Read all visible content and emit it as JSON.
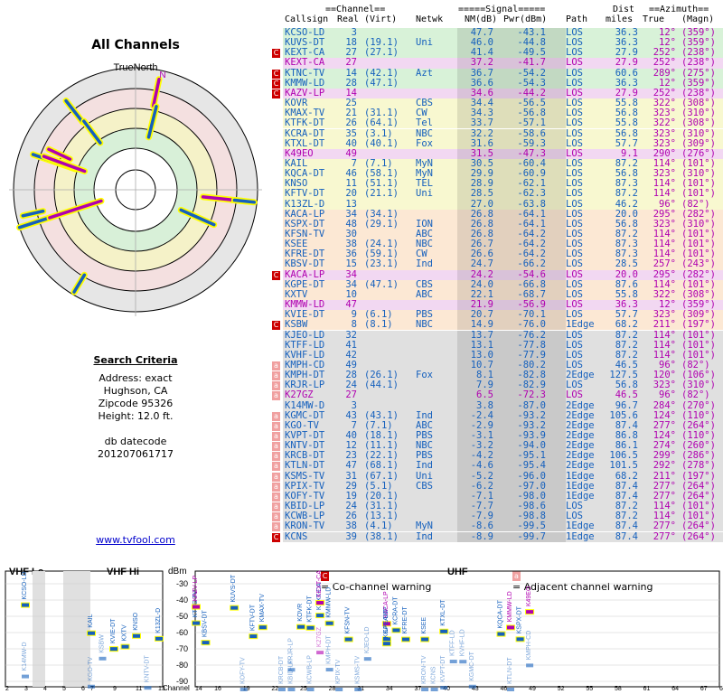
{
  "title": "All Channels",
  "polar_label": "TrueNorth",
  "polar_north": "N",
  "criteria": {
    "heading": "Search Criteria",
    "address": "Address: exact",
    "city": "Hughson, CA",
    "zip": "Zipcode 95326",
    "height": "Height: 12.0 ft.",
    "db_label": "db datecode",
    "db_code": "201207061717"
  },
  "link": "www.tvfool.com",
  "table": {
    "group_channel": "==Channel==",
    "group_signal": "=====Signal=====",
    "group_dist": "Dist",
    "group_azimuth": "==Azimuth==",
    "headers": [
      "Callsign",
      "Real",
      "(Virt)",
      "Netwk",
      "NM(dB)",
      "Pwr(dBm)",
      "Path",
      "miles",
      "True",
      "(Magn)"
    ],
    "rows": [
      {
        "w": "",
        "c": "KCSO-LD",
        "r": "3",
        "v": "",
        "n": "",
        "nm": "47.7",
        "p": "-43.1",
        "path": "LOS",
        "d": "36.3",
        "t": "12°",
        "m": "(359°)",
        "col": "#1560bd",
        "bg": "#d8f2d8"
      },
      {
        "w": "",
        "c": "KUVS-DT",
        "r": "18",
        "v": "(19.1)",
        "n": "Uni",
        "nm": "46.0",
        "p": "-44.8",
        "path": "LOS",
        "d": "36.3",
        "t": "12°",
        "m": "(359°)",
        "col": "#1560bd",
        "bg": "#d8f2d8"
      },
      {
        "w": "C",
        "c": "KEXT-CA",
        "r": "27",
        "v": "(27.1)",
        "n": "",
        "nm": "41.4",
        "p": "-49.5",
        "path": "LOS",
        "d": "27.9",
        "t": "252°",
        "m": "(238°)",
        "col": "#1560bd",
        "bg": "#d8f2d8"
      },
      {
        "w": "",
        "c": "KEXT-CA",
        "r": "27",
        "v": "",
        "n": "",
        "nm": "37.2",
        "p": "-41.7",
        "path": "LOS",
        "d": "27.9",
        "t": "252°",
        "m": "(238°)",
        "col": "#b000b0",
        "bg": "#f2d8f2"
      },
      {
        "w": "C",
        "c": "KTNC-TV",
        "r": "14",
        "v": "(42.1)",
        "n": "Azt",
        "nm": "36.7",
        "p": "-54.2",
        "path": "LOS",
        "d": "60.6",
        "t": "289°",
        "m": "(275°)",
        "col": "#1560bd",
        "bg": "#d8f2d8"
      },
      {
        "w": "C",
        "c": "KMMW-LD",
        "r": "28",
        "v": "(47.1)",
        "n": "",
        "nm": "36.6",
        "p": "-54.3",
        "path": "LOS",
        "d": "36.3",
        "t": "12°",
        "m": "(359°)",
        "col": "#1560bd",
        "bg": "#d8f2d8"
      },
      {
        "w": "C",
        "c": "KAZV-LP",
        "r": "14",
        "v": "",
        "n": "",
        "nm": "34.6",
        "p": "-44.2",
        "path": "LOS",
        "d": "27.9",
        "t": "252°",
        "m": "(238°)",
        "col": "#b000b0",
        "bg": "#f2d8f2"
      },
      {
        "w": "",
        "c": "KOVR",
        "r": "25",
        "v": "",
        "n": "CBS",
        "nm": "34.4",
        "p": "-56.5",
        "path": "LOS",
        "d": "55.8",
        "t": "322°",
        "m": "(308°)",
        "col": "#1560bd",
        "bg": "#f8f8d0"
      },
      {
        "w": "",
        "c": "KMAX-TV",
        "r": "21",
        "v": "(31.1)",
        "n": "CW",
        "nm": "34.3",
        "p": "-56.8",
        "path": "LOS",
        "d": "56.8",
        "t": "323°",
        "m": "(310°)",
        "col": "#1560bd",
        "bg": "#f8f8d0"
      },
      {
        "w": "",
        "c": "KTFK-DT",
        "r": "26",
        "v": "(64.1)",
        "n": "Tel",
        "nm": "33.7",
        "p": "-57.1",
        "path": "LOS",
        "d": "55.8",
        "t": "322°",
        "m": "(308°)",
        "col": "#1560bd",
        "bg": "#f8f8d0"
      },
      {
        "w": "",
        "c": "KCRA-DT",
        "r": "35",
        "v": "(3.1)",
        "n": "NBC",
        "nm": "32.2",
        "p": "-58.6",
        "path": "LOS",
        "d": "56.8",
        "t": "323°",
        "m": "(310°)",
        "col": "#1560bd",
        "bg": "#f8f8d0"
      },
      {
        "w": "",
        "c": "KTXL-DT",
        "r": "40",
        "v": "(40.1)",
        "n": "Fox",
        "nm": "31.6",
        "p": "-59.3",
        "path": "LOS",
        "d": "57.7",
        "t": "323°",
        "m": "(309°)",
        "col": "#1560bd",
        "bg": "#f8f8d0"
      },
      {
        "w": "",
        "c": "K49EO",
        "r": "49",
        "v": "",
        "n": "",
        "nm": "31.5",
        "p": "-47.3",
        "path": "LOS",
        "d": "9.1",
        "t": "290°",
        "m": "(276°)",
        "col": "#b000b0",
        "bg": "#f2d8f2"
      },
      {
        "w": "",
        "c": "KAIL",
        "r": "7",
        "v": "(7.1)",
        "n": "MyN",
        "nm": "30.5",
        "p": "-60.4",
        "path": "LOS",
        "d": "87.2",
        "t": "114°",
        "m": "(101°)",
        "col": "#1560bd",
        "bg": "#f8f8d0"
      },
      {
        "w": "",
        "c": "KQCA-DT",
        "r": "46",
        "v": "(58.1)",
        "n": "MyN",
        "nm": "29.9",
        "p": "-60.9",
        "path": "LOS",
        "d": "56.8",
        "t": "323°",
        "m": "(310°)",
        "col": "#1560bd",
        "bg": "#f8f8d0"
      },
      {
        "w": "",
        "c": "KNSO",
        "r": "11",
        "v": "(51.1)",
        "n": "TEL",
        "nm": "28.9",
        "p": "-62.1",
        "path": "LOS",
        "d": "87.3",
        "t": "114°",
        "m": "(101°)",
        "col": "#1560bd",
        "bg": "#f8f8d0"
      },
      {
        "w": "",
        "c": "KFTV-DT",
        "r": "20",
        "v": "(21.1)",
        "n": "Uni",
        "nm": "28.5",
        "p": "-62.3",
        "path": "LOS",
        "d": "87.2",
        "t": "114°",
        "m": "(101°)",
        "col": "#1560bd",
        "bg": "#f8f8d0"
      },
      {
        "w": "",
        "c": "K13ZL-D",
        "r": "13",
        "v": "",
        "n": "",
        "nm": "27.0",
        "p": "-63.8",
        "path": "LOS",
        "d": "46.2",
        "t": "96°",
        "m": "(82°)",
        "col": "#1560bd",
        "bg": "#f8f8d0"
      },
      {
        "w": "",
        "c": "KACA-LP",
        "r": "34",
        "v": "(34.1)",
        "n": "",
        "nm": "26.8",
        "p": "-64.1",
        "path": "LOS",
        "d": "20.0",
        "t": "295°",
        "m": "(282°)",
        "col": "#1560bd",
        "bg": "#fce8d4"
      },
      {
        "w": "",
        "c": "KSPX-DT",
        "r": "48",
        "v": "(29.1)",
        "n": "ION",
        "nm": "26.8",
        "p": "-64.1",
        "path": "LOS",
        "d": "56.8",
        "t": "323°",
        "m": "(310°)",
        "col": "#1560bd",
        "bg": "#fce8d4"
      },
      {
        "w": "",
        "c": "KFSN-TV",
        "r": "30",
        "v": "",
        "n": "ABC",
        "nm": "26.8",
        "p": "-64.2",
        "path": "LOS",
        "d": "87.2",
        "t": "114°",
        "m": "(101°)",
        "col": "#1560bd",
        "bg": "#fce8d4"
      },
      {
        "w": "",
        "c": "KSEE",
        "r": "38",
        "v": "(24.1)",
        "n": "NBC",
        "nm": "26.7",
        "p": "-64.2",
        "path": "LOS",
        "d": "87.3",
        "t": "114°",
        "m": "(101°)",
        "col": "#1560bd",
        "bg": "#fce8d4"
      },
      {
        "w": "",
        "c": "KFRE-DT",
        "r": "36",
        "v": "(59.1)",
        "n": "CW",
        "nm": "26.6",
        "p": "-64.2",
        "path": "LOS",
        "d": "87.3",
        "t": "114°",
        "m": "(101°)",
        "col": "#1560bd",
        "bg": "#fce8d4"
      },
      {
        "w": "",
        "c": "KBSV-DT",
        "r": "15",
        "v": "(23.1)",
        "n": "Ind",
        "nm": "24.7",
        "p": "-66.2",
        "path": "LOS",
        "d": "28.5",
        "t": "257°",
        "m": "(243°)",
        "col": "#1560bd",
        "bg": "#fce8d4"
      },
      {
        "w": "C",
        "c": "KACA-LP",
        "r": "34",
        "v": "",
        "n": "",
        "nm": "24.2",
        "p": "-54.6",
        "path": "LOS",
        "d": "20.0",
        "t": "295°",
        "m": "(282°)",
        "col": "#b000b0",
        "bg": "#f2d8f2"
      },
      {
        "w": "",
        "c": "KGPE-DT",
        "r": "34",
        "v": "(47.1)",
        "n": "CBS",
        "nm": "24.0",
        "p": "-66.8",
        "path": "LOS",
        "d": "87.6",
        "t": "114°",
        "m": "(101°)",
        "col": "#1560bd",
        "bg": "#fce8d4"
      },
      {
        "w": "",
        "c": "KXTV",
        "r": "10",
        "v": "",
        "n": "ABC",
        "nm": "22.1",
        "p": "-68.7",
        "path": "LOS",
        "d": "55.8",
        "t": "322°",
        "m": "(308°)",
        "col": "#1560bd",
        "bg": "#fce8d4"
      },
      {
        "w": "",
        "c": "KMMW-LD",
        "r": "47",
        "v": "",
        "n": "",
        "nm": "21.9",
        "p": "-56.9",
        "path": "LOS",
        "d": "36.3",
        "t": "12°",
        "m": "(359°)",
        "col": "#b000b0",
        "bg": "#f2d8f2"
      },
      {
        "w": "",
        "c": "KVIE-DT",
        "r": "9",
        "v": "(6.1)",
        "n": "PBS",
        "nm": "20.7",
        "p": "-70.1",
        "path": "LOS",
        "d": "57.7",
        "t": "323°",
        "m": "(309°)",
        "col": "#1560bd",
        "bg": "#fce8d4"
      },
      {
        "w": "C",
        "c": "KSBW",
        "r": "8",
        "v": "(8.1)",
        "n": "NBC",
        "nm": "14.9",
        "p": "-76.0",
        "path": "1Edge",
        "d": "68.2",
        "t": "211°",
        "m": "(197°)",
        "col": "#1560bd",
        "bg": "#fce8d4"
      },
      {
        "w": "",
        "c": "KJEO-LD",
        "r": "32",
        "v": "",
        "n": "",
        "nm": "13.7",
        "p": "-76.2",
        "path": "LOS",
        "d": "87.2",
        "t": "114°",
        "m": "(101°)",
        "col": "#1560bd",
        "bg": "#e0e0e0"
      },
      {
        "w": "",
        "c": "KTFF-LD",
        "r": "41",
        "v": "",
        "n": "",
        "nm": "13.1",
        "p": "-77.8",
        "path": "LOS",
        "d": "87.2",
        "t": "114°",
        "m": "(101°)",
        "col": "#1560bd",
        "bg": "#e0e0e0"
      },
      {
        "w": "",
        "c": "KVHF-LD",
        "r": "42",
        "v": "",
        "n": "",
        "nm": "13.0",
        "p": "-77.9",
        "path": "LOS",
        "d": "87.2",
        "t": "114°",
        "m": "(101°)",
        "col": "#1560bd",
        "bg": "#e0e0e0"
      },
      {
        "w": "a",
        "c": "KMPH-CD",
        "r": "49",
        "v": "",
        "n": "",
        "nm": "10.7",
        "p": "-80.2",
        "path": "LOS",
        "d": "46.5",
        "t": "96°",
        "m": "(82°)",
        "col": "#1560bd",
        "bg": "#e0e0e0"
      },
      {
        "w": "a",
        "c": "KMPH-DT",
        "r": "28",
        "v": "(26.1)",
        "n": "Fox",
        "nm": "8.1",
        "p": "-82.8",
        "path": "2Edge",
        "d": "127.5",
        "t": "120°",
        "m": "(106°)",
        "col": "#1560bd",
        "bg": "#e0e0e0"
      },
      {
        "w": "a",
        "c": "KRJR-LP",
        "r": "24",
        "v": "(44.1)",
        "n": "",
        "nm": "7.9",
        "p": "-82.9",
        "path": "LOS",
        "d": "56.8",
        "t": "323°",
        "m": "(310°)",
        "col": "#1560bd",
        "bg": "#e0e0e0"
      },
      {
        "w": "a",
        "c": "K27GZ",
        "r": "27",
        "v": "",
        "n": "",
        "nm": "6.5",
        "p": "-72.3",
        "path": "LOS",
        "d": "46.5",
        "t": "96°",
        "m": "(82°)",
        "col": "#b000b0",
        "bg": "#e0e0e0"
      },
      {
        "w": "",
        "c": "K14MW-D",
        "r": "3",
        "v": "",
        "n": "",
        "nm": "3.8",
        "p": "-87.0",
        "path": "2Edge",
        "d": "96.7",
        "t": "284°",
        "m": "(270°)",
        "col": "#1560bd",
        "bg": "#e0e0e0"
      },
      {
        "w": "a",
        "c": "KGMC-DT",
        "r": "43",
        "v": "(43.1)",
        "n": "Ind",
        "nm": "-2.4",
        "p": "-93.2",
        "path": "2Edge",
        "d": "105.6",
        "t": "124°",
        "m": "(110°)",
        "col": "#1560bd",
        "bg": "#e0e0e0"
      },
      {
        "w": "a",
        "c": "KGO-TV",
        "r": "7",
        "v": "(7.1)",
        "n": "ABC",
        "nm": "-2.9",
        "p": "-93.2",
        "path": "2Edge",
        "d": "87.4",
        "t": "277°",
        "m": "(264°)",
        "col": "#1560bd",
        "bg": "#e0e0e0"
      },
      {
        "w": "a",
        "c": "KVPT-DT",
        "r": "40",
        "v": "(18.1)",
        "n": "PBS",
        "nm": "-3.1",
        "p": "-93.9",
        "path": "2Edge",
        "d": "86.8",
        "t": "124°",
        "m": "(110°)",
        "col": "#1560bd",
        "bg": "#e0e0e0"
      },
      {
        "w": "a",
        "c": "KNTV-DT",
        "r": "12",
        "v": "(11.1)",
        "n": "NBC",
        "nm": "-3.2",
        "p": "-94.0",
        "path": "2Edge",
        "d": "86.1",
        "t": "274°",
        "m": "(260°)",
        "col": "#1560bd",
        "bg": "#e0e0e0"
      },
      {
        "w": "a",
        "c": "KRCB-DT",
        "r": "23",
        "v": "(22.1)",
        "n": "PBS",
        "nm": "-4.2",
        "p": "-95.1",
        "path": "2Edge",
        "d": "106.5",
        "t": "299°",
        "m": "(286°)",
        "col": "#1560bd",
        "bg": "#e0e0e0"
      },
      {
        "w": "a",
        "c": "KTLN-DT",
        "r": "47",
        "v": "(68.1)",
        "n": "Ind",
        "nm": "-4.6",
        "p": "-95.4",
        "path": "2Edge",
        "d": "101.5",
        "t": "292°",
        "m": "(278°)",
        "col": "#1560bd",
        "bg": "#e0e0e0"
      },
      {
        "w": "a",
        "c": "KSMS-TV",
        "r": "31",
        "v": "(67.1)",
        "n": "Uni",
        "nm": "-5.2",
        "p": "-96.0",
        "path": "1Edge",
        "d": "68.2",
        "t": "211°",
        "m": "(197°)",
        "col": "#1560bd",
        "bg": "#e0e0e0"
      },
      {
        "w": "a",
        "c": "KPIX-TV",
        "r": "29",
        "v": "(5.1)",
        "n": "CBS",
        "nm": "-6.2",
        "p": "-97.0",
        "path": "1Edge",
        "d": "87.4",
        "t": "277°",
        "m": "(264°)",
        "col": "#1560bd",
        "bg": "#e0e0e0"
      },
      {
        "w": "a",
        "c": "KOFY-TV",
        "r": "19",
        "v": "(20.1)",
        "n": "",
        "nm": "-7.1",
        "p": "-98.0",
        "path": "1Edge",
        "d": "87.4",
        "t": "277°",
        "m": "(264°)",
        "col": "#1560bd",
        "bg": "#e0e0e0"
      },
      {
        "w": "a",
        "c": "KBID-LP",
        "r": "24",
        "v": "(31.1)",
        "n": "",
        "nm": "-7.7",
        "p": "-98.6",
        "path": "LOS",
        "d": "87.2",
        "t": "114°",
        "m": "(101°)",
        "col": "#1560bd",
        "bg": "#e0e0e0"
      },
      {
        "w": "a",
        "c": "KCWB-LP",
        "r": "26",
        "v": "(13.1)",
        "n": "",
        "nm": "-7.9",
        "p": "-98.8",
        "path": "LOS",
        "d": "87.2",
        "t": "114°",
        "m": "(101°)",
        "col": "#1560bd",
        "bg": "#e0e0e0"
      },
      {
        "w": "a",
        "c": "KRON-TV",
        "r": "38",
        "v": "(4.1)",
        "n": "MyN",
        "nm": "-8.6",
        "p": "-99.5",
        "path": "1Edge",
        "d": "87.4",
        "t": "277°",
        "m": "(264°)",
        "col": "#1560bd",
        "bg": "#e0e0e0"
      },
      {
        "w": "C",
        "c": "KCNS",
        "r": "39",
        "v": "(38.1)",
        "n": "Ind",
        "nm": "-8.9",
        "p": "-99.7",
        "path": "1Edge",
        "d": "87.4",
        "t": "277°",
        "m": "(264°)",
        "col": "#1560bd",
        "bg": "#e0e0e0"
      }
    ]
  },
  "legend": {
    "co": "= Co-channel warning",
    "adj": "= Adjacent channel warning",
    "co_mark": "C",
    "adj_mark": "a"
  },
  "spectrum": {
    "vhf_lo": "VHF Lo",
    "vhf_hi": "VHF Hi",
    "uhf": "UHF",
    "dbm": "dBm",
    "channel_label": "Channel",
    "yticks": [
      "-30",
      "-40",
      "-50",
      "-60",
      "-70",
      "-80",
      "-90"
    ],
    "vhf_lo_ticks": [
      "2",
      "3",
      "4",
      "5",
      "6"
    ],
    "vhf_hi_ticks": [
      "7",
      "9",
      "11",
      "13"
    ],
    "uhf_ticks": [
      "14",
      "16",
      "19",
      "22",
      "25",
      "28",
      "31",
      "34",
      "37",
      "40",
      "43",
      "46",
      "49",
      "52",
      "55",
      "58",
      "61",
      "64",
      "67",
      "69"
    ]
  },
  "chart_data": {
    "type": "scatter",
    "title": "All Channels",
    "polar": true,
    "colors": {
      "digital": "#1560bd",
      "analog": "#b000b0",
      "highlight": "#ffff00"
    }
  }
}
